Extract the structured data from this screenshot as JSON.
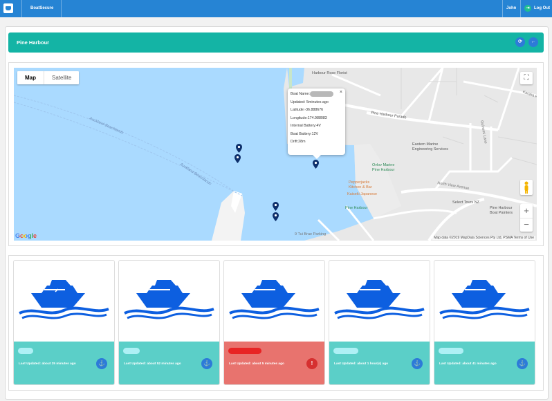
{
  "topbar": {
    "brand": "BoatSecure",
    "user": "John",
    "logout_label": "Log Out"
  },
  "header": {
    "title": "Pine Harbour"
  },
  "map": {
    "type_buttons": [
      "Map",
      "Satellite"
    ],
    "labels": {
      "florist": "Harbour Rose Florist",
      "parade": "Pine Harbour Parade",
      "marine_line1": "Eastern Marine",
      "marine_line2": "Engineering Services",
      "ovlov1": "Ovlov Marine",
      "ovlov2": "Pine Harbour",
      "peppers1": "Pepperjacks",
      "peppers2": "Kitchen & Bar",
      "kaiseki": "Kaiseki Japanese",
      "pineharbour": "Pine Harbour",
      "select": "Select Tours NZ",
      "painters1": "Pine Harbour",
      "painters2": "Boat Painters",
      "northview": "North View Avenue",
      "tuibrae": "9 Tui Brae Parking",
      "beachlands1": "Auckland-Beachlands",
      "beachlands2": "Auckland-Beachlands",
      "guiness": "Guiness Lane",
      "karaka": "Karaka R"
    },
    "info": {
      "boat_name_label": "Boat Name:",
      "updated": "Updated: 5minutes ago",
      "latitude": "Latitude:-36.888676",
      "longitude": "Longitude:174.988083",
      "internal_battery": "Internal Battery:4V",
      "boat_battery": "Boat Battery:12V",
      "drift": "Drift:28m",
      "close": "×"
    },
    "google": "Google",
    "attribution": "Map data ©2019 MapData Sciences Pty Ltd, PSMA   Terms of Use"
  },
  "cards": [
    {
      "status": "Last Updated: about 25 minutes ago",
      "state": "ok",
      "icon": "anchor-icon"
    },
    {
      "status": "Last Updated: about 52 minutes ago",
      "state": "ok",
      "icon": "anchor-icon"
    },
    {
      "status": "Last Updated: about 5 minutes ago",
      "state": "alert",
      "icon": "alert-icon"
    },
    {
      "status": "Last Updated: about 1 hour(s) ago",
      "state": "ok",
      "icon": "anchor-icon"
    },
    {
      "status": "Last Updated: about 41 minutes ago",
      "state": "ok",
      "icon": "anchor-icon"
    }
  ],
  "colors": {
    "topbar": "#2684d4",
    "header": "#14b4a5",
    "card_ok": "#5bcfc8",
    "card_alert": "#e8736e",
    "water": "#aadaff"
  }
}
